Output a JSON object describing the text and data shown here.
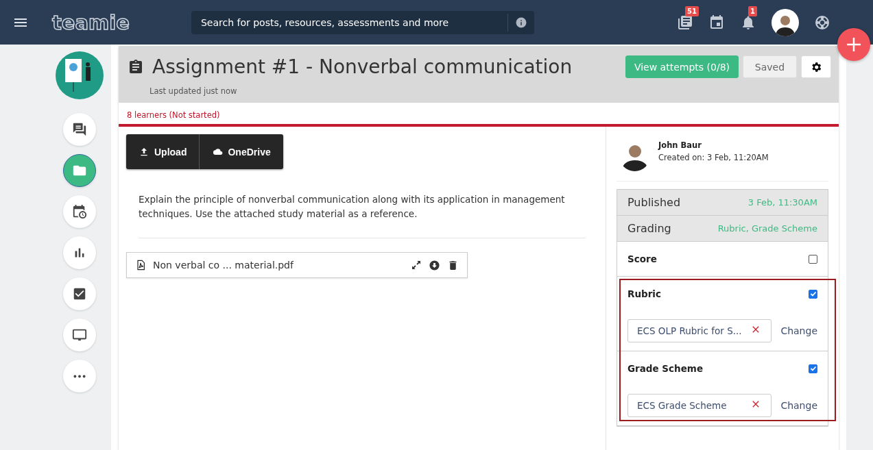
{
  "topbar": {
    "logo": "teamie",
    "search": {
      "placeholder": "Search for posts, resources, assessments and more"
    },
    "icons": [
      {
        "kind": "news",
        "badge": "51"
      },
      {
        "kind": "calendar"
      },
      {
        "kind": "bell",
        "badge": "1"
      },
      {
        "kind": "avatar"
      },
      {
        "kind": "help"
      }
    ]
  },
  "sidebar": {
    "items": [
      {
        "kind": "chat",
        "selected": false
      },
      {
        "kind": "folder",
        "selected": true
      },
      {
        "kind": "schedule",
        "selected": false
      },
      {
        "kind": "chart",
        "selected": false
      },
      {
        "kind": "check",
        "selected": false
      },
      {
        "kind": "monitor",
        "selected": false
      },
      {
        "kind": "more",
        "selected": false
      }
    ]
  },
  "assignment": {
    "title": "Assignment #1 - Nonverbal communication",
    "updated": "Last updated just now",
    "primary_button": "View attempts (0/8)",
    "saved_button": "Saved",
    "learners": "8 learners (Not started)",
    "upload_buttons": [
      {
        "kind": "upload",
        "label": "Upload"
      },
      {
        "kind": "cloud",
        "label": "OneDrive"
      }
    ],
    "description": "Explain the principle of nonverbal communication along with its application in management techniques. Use the attached study material as a reference.",
    "attachment": "Non verbal co ... material.pdf"
  },
  "details": {
    "author": "John Baur",
    "created": "Created on: 3 Feb, 11:20AM",
    "info_rows": [
      {
        "label": "Published",
        "value": "3 Feb, 11:30AM"
      },
      {
        "label": "Grading",
        "value": "Rubric, Grade Scheme"
      }
    ],
    "options": [
      {
        "label": "Score",
        "checked": false
      },
      {
        "label": "Rubric",
        "checked": true,
        "chip": "ECS OLP Rubric for S...",
        "action": "Change"
      },
      {
        "label": "Grade Scheme",
        "checked": true,
        "chip": "ECS Grade Scheme",
        "action": "Change"
      }
    ]
  }
}
